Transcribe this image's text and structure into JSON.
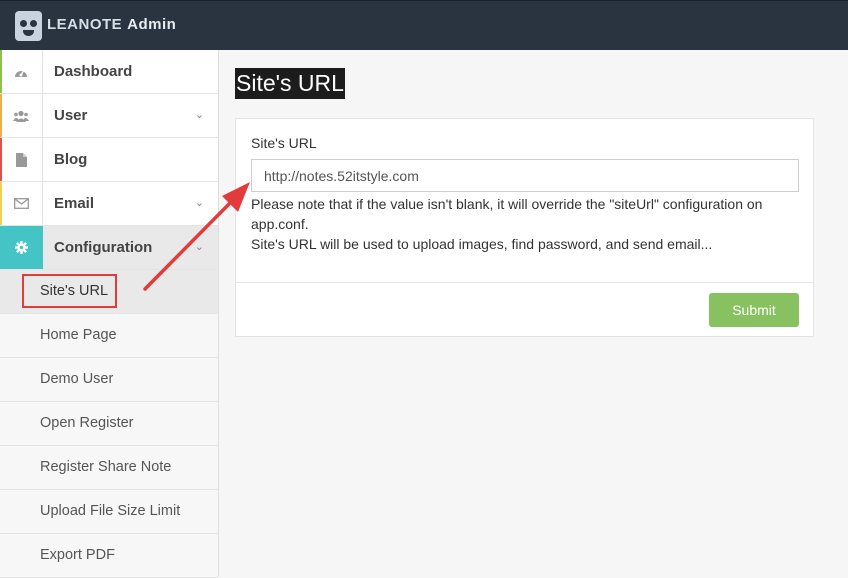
{
  "header": {
    "brand": "LEANOTE",
    "suffix": "Admin"
  },
  "sidebar": {
    "items": [
      {
        "label": "Dashboard",
        "icon": "dashboard-icon",
        "accent": "#8bc34a"
      },
      {
        "label": "User",
        "icon": "users-icon",
        "chevron": "chevron-down-icon",
        "accent": "#f0ad4e"
      },
      {
        "label": "Blog",
        "icon": "file-icon",
        "accent": "#d9534f"
      },
      {
        "label": "Email",
        "icon": "envelope-icon",
        "chevron": "chevron-down-icon",
        "accent": "#f0d04e"
      },
      {
        "label": "Configuration",
        "icon": "gear-icon",
        "chevron": "chevron-down-icon",
        "accent": "#45c4c6"
      }
    ],
    "subitems": [
      "Site's URL",
      "Home Page",
      "Demo User",
      "Open Register",
      "Register Share Note",
      "Upload File Size Limit",
      "Export PDF"
    ]
  },
  "main": {
    "title": "Site's URL",
    "form": {
      "label": "Site's URL",
      "value": "http://notes.52itstyle.com",
      "help_line1": "Please note that if the value isn't blank, it will override the \"siteUrl\" configuration on app.conf.",
      "help_line2": "Site's URL will be used to upload images, find password, and send email...",
      "submit": "Submit"
    }
  },
  "colors": {
    "topbar": "#2a3441",
    "active": "#45c4c6",
    "submit": "#88c160",
    "highlight": "#e23b3b"
  }
}
